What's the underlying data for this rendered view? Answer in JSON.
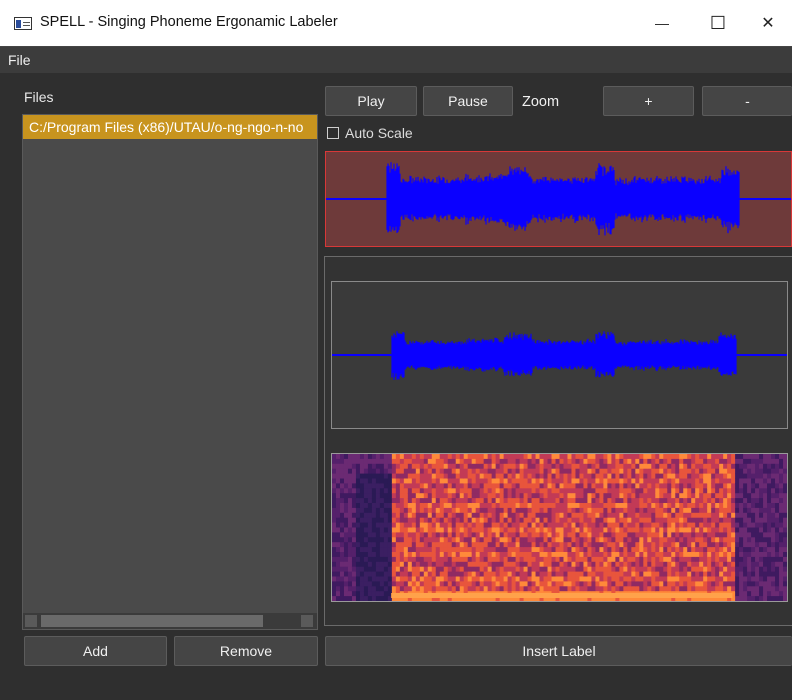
{
  "window": {
    "title": "SPELL - Singing Phoneme Ergonamic Labeler",
    "minimize_glyph": "—",
    "maximize_glyph": "☐",
    "close_glyph": "✕"
  },
  "menu": {
    "file": "File"
  },
  "files_panel": {
    "label": "Files",
    "items": [
      {
        "path": "C:/Program Files (x86)/UTAU/o-ng-ngo-n-no"
      }
    ]
  },
  "toolbar": {
    "play": "Play",
    "pause": "Pause",
    "zoom_label": "Zoom",
    "zoom_in": "+",
    "zoom_out": "-",
    "auto_scale": "Auto Scale"
  },
  "bottom": {
    "add": "Add",
    "remove": "Remove",
    "insert_label": "Insert Label"
  },
  "colors": {
    "selection": "#c8941e",
    "waveform": "#0a00ff",
    "selected_wave_border": "#d83838",
    "selected_wave_bg": "#6e3a3a"
  },
  "icons": {
    "app": "app-window-icon",
    "minimize": "minimize-icon",
    "maximize": "maximize-icon",
    "close": "close-icon"
  }
}
